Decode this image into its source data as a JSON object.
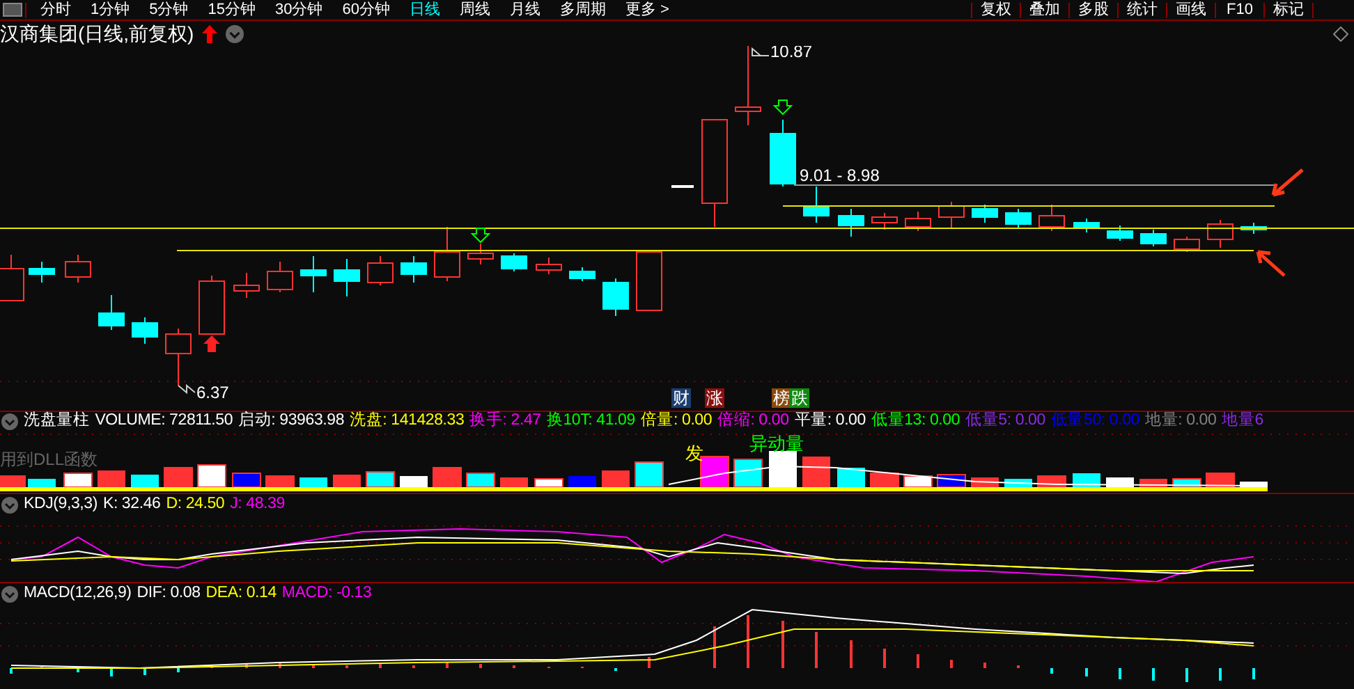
{
  "toolbar": {
    "periods": [
      {
        "label": "分时",
        "selected": false
      },
      {
        "label": "1分钟",
        "selected": false
      },
      {
        "label": "5分钟",
        "selected": false
      },
      {
        "label": "15分钟",
        "selected": false
      },
      {
        "label": "30分钟",
        "selected": false
      },
      {
        "label": "60分钟",
        "selected": false
      },
      {
        "label": "日线",
        "selected": true
      },
      {
        "label": "周线",
        "selected": false
      },
      {
        "label": "月线",
        "selected": false
      },
      {
        "label": "多周期",
        "selected": false
      },
      {
        "label": "更多 >",
        "selected": false
      }
    ],
    "tools": [
      "复权",
      "叠加",
      "多股",
      "统计",
      "画线",
      "F10",
      "标记"
    ]
  },
  "stock_title": "汉商集团(日线,前复权)",
  "price_chart": {
    "high_label": "10.87",
    "low_label": "6.37",
    "range_label": "9.01 - 8.98"
  },
  "event_badges": [
    {
      "label": "财",
      "color": "#1c3d6e"
    },
    {
      "label": "涨",
      "color": "#8c1010"
    },
    {
      "label": "榜",
      "color": "#8a4a0c"
    },
    {
      "label": "跌",
      "color": "#108a10"
    }
  ],
  "volume_panel": {
    "name": "洗盘量柱",
    "readings": [
      {
        "text": "VOLUME: 72811.50",
        "color": "#ffffff"
      },
      {
        "text": "启动: 93963.98",
        "color": "#ffffff"
      },
      {
        "text": "洗盘: 141428.33",
        "color": "#ffff00"
      },
      {
        "text": "换手: 2.47",
        "color": "#ff00ff"
      },
      {
        "text": "换10T: 41.09",
        "color": "#00ff00"
      },
      {
        "text": "倍量: 0.00",
        "color": "#ffff00"
      },
      {
        "text": "倍缩: 0.00",
        "color": "#ff00ff"
      },
      {
        "text": "平量: 0.00",
        "color": "#ffffff"
      },
      {
        "text": "低量13: 0.00",
        "color": "#00ff00"
      },
      {
        "text": "低量5: 0.00",
        "color": "#8a2be2"
      },
      {
        "text": "低量50: 0.00",
        "color": "#0000ff"
      },
      {
        "text": "地量: 0.00",
        "color": "#808080"
      },
      {
        "text": "地量6",
        "color": "#8a2be2"
      }
    ],
    "note": "用到DLL函数",
    "signal_mark": "发",
    "spike_mark": "异动量"
  },
  "kdj_panel": {
    "name": "KDJ(9,3,3)",
    "readings": [
      {
        "text": "K: 32.46",
        "color": "#ffffff"
      },
      {
        "text": "D: 24.50",
        "color": "#ffff00"
      },
      {
        "text": "J: 48.39",
        "color": "#ff00ff"
      }
    ]
  },
  "macd_panel": {
    "name": "MACD(12,26,9)",
    "readings": [
      {
        "text": "DIF: 0.08",
        "color": "#ffffff"
      },
      {
        "text": "DEA: 0.14",
        "color": "#ffff00"
      },
      {
        "text": "MACD: -0.13",
        "color": "#ff00ff"
      }
    ]
  }
}
